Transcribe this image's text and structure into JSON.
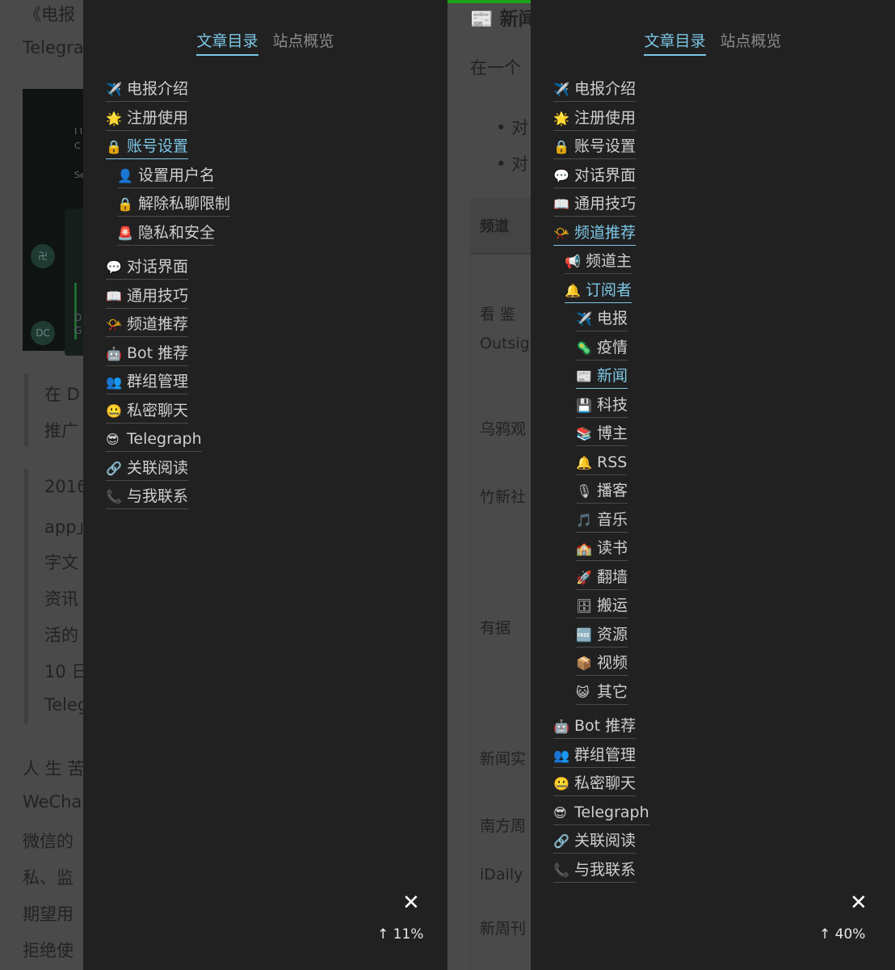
{
  "left": {
    "background": {
      "lines": [
        "《电报",
        "Telegra",
        "在 D",
        "推广",
        "2016",
        "app」",
        "字文",
        "资讯",
        "活的",
        "10 日",
        "Teleg",
        "人 生 苦",
        "WeCha",
        "微信的",
        "私、监",
        "期望用",
        "拒绝使"
      ],
      "image_avatar_top": "卍",
      "image_avatar_bottom": "DC",
      "image_label_top": "I I",
      "image_label_top2": "C",
      "image_label_mid": "Se",
      "image_label_d": "D",
      "image_label_g": "G"
    },
    "tabs": [
      "文章目录",
      "站点概览"
    ],
    "toc": [
      {
        "icon": "✈️",
        "label": "电报介绍"
      },
      {
        "icon": "🌟",
        "label": "注册使用"
      },
      {
        "icon": "🔒",
        "label": "账号设置"
      },
      {
        "icon": "👤",
        "label": "设置用户名"
      },
      {
        "icon": "🔒",
        "label": "解除私聊限制"
      },
      {
        "icon": "🚨",
        "label": "隐私和安全"
      },
      {
        "icon": "💬",
        "label": "对话界面"
      },
      {
        "icon": "📖",
        "label": "通用技巧"
      },
      {
        "icon": "📯",
        "label": "频道推荐"
      },
      {
        "icon": "🤖",
        "label": "Bot 推荐"
      },
      {
        "icon": "👥",
        "label": "群组管理"
      },
      {
        "icon": "🤐",
        "label": "私密聊天"
      },
      {
        "icon": "😎",
        "label": "Telegraph"
      },
      {
        "icon": "🔗",
        "label": "关联阅读"
      },
      {
        "icon": "📞",
        "label": "与我联系"
      }
    ],
    "close": "✕",
    "progress_label": "↑ 11%",
    "progress": 0.11
  },
  "right": {
    "background": {
      "heading": "📰 新闻",
      "intro": "在一个",
      "bullet1": "• 对",
      "bullet2": "• 对",
      "table_header": "频道",
      "rows": [
        "看 鉴",
        "Outsig",
        "乌鸦观",
        "竹新社",
        "有据",
        "新闻实",
        "南方周",
        "iDaily",
        "新周刊"
      ]
    },
    "tabs": [
      "文章目录",
      "站点概览"
    ],
    "toc": [
      {
        "icon": "✈️",
        "label": "电报介绍"
      },
      {
        "icon": "🌟",
        "label": "注册使用"
      },
      {
        "icon": "🔒",
        "label": "账号设置"
      },
      {
        "icon": "💬",
        "label": "对话界面"
      },
      {
        "icon": "📖",
        "label": "通用技巧"
      },
      {
        "icon": "📯",
        "label": "频道推荐"
      },
      {
        "icon": "📢",
        "label": "频道主"
      },
      {
        "icon": "🔔",
        "label": "订阅者"
      },
      {
        "icon": "✈️",
        "label": "电报"
      },
      {
        "icon": "🦠",
        "label": "疫情"
      },
      {
        "icon": "📰",
        "label": "新闻"
      },
      {
        "icon": "💾",
        "label": "科技"
      },
      {
        "icon": "📚",
        "label": "博主"
      },
      {
        "icon": "🔔",
        "label": "RSS"
      },
      {
        "icon": "🎙",
        "label": "播客"
      },
      {
        "icon": "🎵",
        "label": "音乐"
      },
      {
        "icon": "🏫",
        "label": "读书"
      },
      {
        "icon": "🚀",
        "label": "翻墙"
      },
      {
        "icon": "🗄",
        "label": "搬运"
      },
      {
        "icon": "🆓",
        "label": "资源"
      },
      {
        "icon": "📦",
        "label": "视频"
      },
      {
        "icon": "😺",
        "label": "其它"
      },
      {
        "icon": "🤖",
        "label": "Bot 推荐"
      },
      {
        "icon": "👥",
        "label": "群组管理"
      },
      {
        "icon": "🤐",
        "label": "私密聊天"
      },
      {
        "icon": "😎",
        "label": "Telegraph"
      },
      {
        "icon": "🔗",
        "label": "关联阅读"
      },
      {
        "icon": "📞",
        "label": "与我联系"
      }
    ],
    "close": "✕",
    "progress_label": "↑ 40%",
    "progress": 0.4
  },
  "colors": {
    "accent": "#7cc7e6",
    "progress": "#1aa31a",
    "panel": "#212121"
  }
}
